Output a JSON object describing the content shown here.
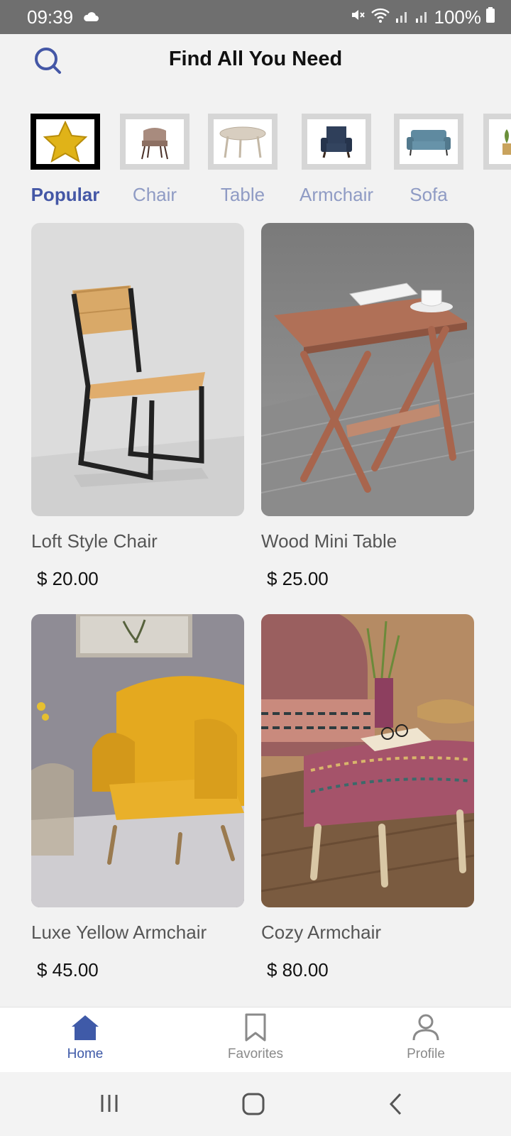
{
  "status": {
    "time": "09:39",
    "battery": "100%"
  },
  "header": {
    "title": "Find All You Need"
  },
  "categories": [
    {
      "label": "Popular",
      "icon": "star-icon",
      "active": true
    },
    {
      "label": "Chair",
      "icon": "chair-icon"
    },
    {
      "label": "Table",
      "icon": "table-icon"
    },
    {
      "label": "Armchair",
      "icon": "armchair-icon"
    },
    {
      "label": "Sofa",
      "icon": "sofa-icon"
    }
  ],
  "products": [
    {
      "name": "Loft Style Chair",
      "price": "$ 20.00"
    },
    {
      "name": "Wood Mini Table",
      "price": "$ 25.00"
    },
    {
      "name": "Luxe Yellow Armchair",
      "price": "$ 45.00"
    },
    {
      "name": "Cozy Armchair",
      "price": "$ 80.00"
    }
  ],
  "nav": {
    "home": "Home",
    "favorites": "Favorites",
    "profile": "Profile"
  },
  "colors": {
    "accent": "#4457a6",
    "inactive": "#8f9bc4"
  }
}
